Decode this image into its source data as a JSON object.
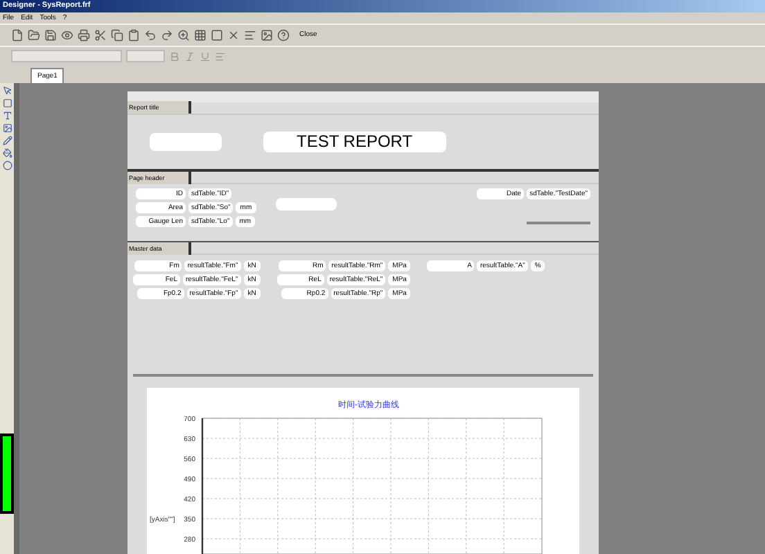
{
  "window": {
    "title": "Designer - SysReport.frf"
  },
  "menu": [
    "File",
    "Edit",
    "Tools",
    "?"
  ],
  "toolbar": {
    "close_button": "Close"
  },
  "tabs": [
    {
      "label": "Page1",
      "selected": true
    }
  ],
  "title_band": {
    "label": "Report title",
    "heading": "TEST REPORT"
  },
  "header_band": {
    "label": "Page header",
    "fields": [
      {
        "label": "ID",
        "value": "sdTable.\"ID\""
      },
      {
        "label": "Area",
        "value": "sdTable.\"So\"",
        "unit": "mm"
      },
      {
        "label": "Gauge Len",
        "value": "sdTable.\"Lo\"",
        "unit": "mm"
      }
    ],
    "date": {
      "label": "Date",
      "value": "sdTable.\"TestDate\""
    }
  },
  "master_band": {
    "label": "Master data",
    "columns": [
      [
        {
          "label": "Fm",
          "value": "resultTable.\"Fm\"",
          "unit": "kN"
        },
        {
          "label": "FeL",
          "value": "resultTable.\"FeL\"",
          "unit": "kN"
        },
        {
          "label": "Fp0.2",
          "value": "resultTable.\"Fp\"",
          "unit": "kN"
        }
      ],
      [
        {
          "label": "Rm",
          "value": "resultTable.\"Rm\"",
          "unit": "MPa"
        },
        {
          "label": "ReL",
          "value": "resultTable.\"ReL\"",
          "unit": "MPa"
        },
        {
          "label": "Rp0.2",
          "value": "resultTable.\"Rp\"",
          "unit": "MPa"
        }
      ],
      [
        {
          "label": "A",
          "value": "resultTable.\"A\"",
          "unit": "%"
        }
      ]
    ]
  },
  "chart": {
    "title": "时间-试验力曲线",
    "ylabel": "[yAxis\"\"]",
    "y_tick_labels": [
      "700",
      "630",
      "560",
      "490",
      "420",
      "350",
      "280"
    ]
  }
}
